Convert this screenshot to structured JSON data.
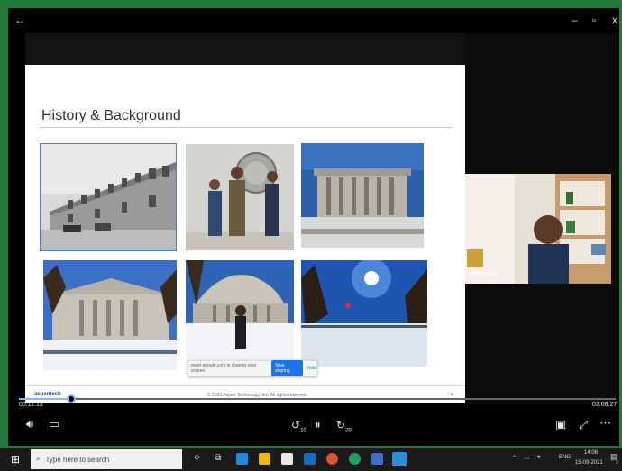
{
  "window": {
    "back_icon": "arrow-left-icon",
    "minimize": "–",
    "restore": "▫",
    "close": "x"
  },
  "slide": {
    "title": "History & Background",
    "photos": [
      {
        "name": "building-black-white"
      },
      {
        "name": "people-with-seal"
      },
      {
        "name": "classical-building"
      },
      {
        "name": "campus-panorama"
      },
      {
        "name": "person-in-snow"
      },
      {
        "name": "sun-over-campus"
      }
    ],
    "share_notice": {
      "text": "meet.google.com is sharing your screen.",
      "stop_label": "Stop sharing",
      "hide_label": "Hide"
    },
    "footer": {
      "logo": "aspentech",
      "copyright": "© 2020 Aspen Technology, Inc. All rights reserved.",
      "page": "4"
    }
  },
  "webcam": {
    "name_label": "Sunil Patil"
  },
  "player": {
    "elapsed": "00:11:13",
    "duration": "02:08:27",
    "progress": 0.087,
    "skip_back": "10",
    "skip_forward": "30"
  },
  "taskbar": {
    "search_placeholder": "Type here to search",
    "lang": "ENG",
    "time": "14:06",
    "date": "15-09-2021",
    "notif_count": "2"
  },
  "colors": {
    "frame_green": "#1f7a3a",
    "accent": "#8ab4f8",
    "share_blue": "#1a73e8"
  }
}
